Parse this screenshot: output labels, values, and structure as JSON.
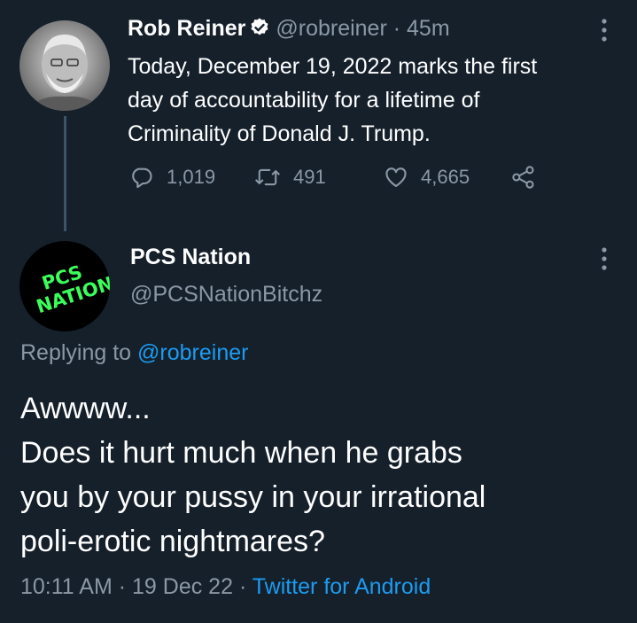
{
  "colors": {
    "background": "#15202b",
    "muted": "#8b98a5",
    "link": "#1d9bf0",
    "verified": "#ffffff"
  },
  "parent": {
    "display_name": "Rob Reiner",
    "handle": "@robreiner",
    "separator": "·",
    "time_ago": "45m",
    "text_lines": [
      "Today, December 19, 2022 marks the first",
      "day of accountability for a lifetime of",
      "Criminality of Donald J. Trump."
    ],
    "actions": {
      "replies": "1,019",
      "retweets": "491",
      "likes": "4,665"
    },
    "icons": [
      "verified-badge-icon",
      "more-options-icon",
      "reply-icon",
      "retweet-icon",
      "like-icon",
      "share-icon"
    ]
  },
  "reply": {
    "display_name": "PCS Nation",
    "handle": "@PCSNationBitchz",
    "avatar_text_line1": "PCS",
    "avatar_text_line2": "NATION",
    "replying_prefix": "Replying to",
    "replying_handle": "@robreiner",
    "body_lines": [
      "Awwww...",
      "Does it hurt much when he grabs",
      "you by your pussy in your irrational",
      "poli-erotic nightmares?"
    ],
    "time": "10:11 AM",
    "date": "19 Dec 22",
    "separator": "·",
    "source": "Twitter for Android"
  }
}
